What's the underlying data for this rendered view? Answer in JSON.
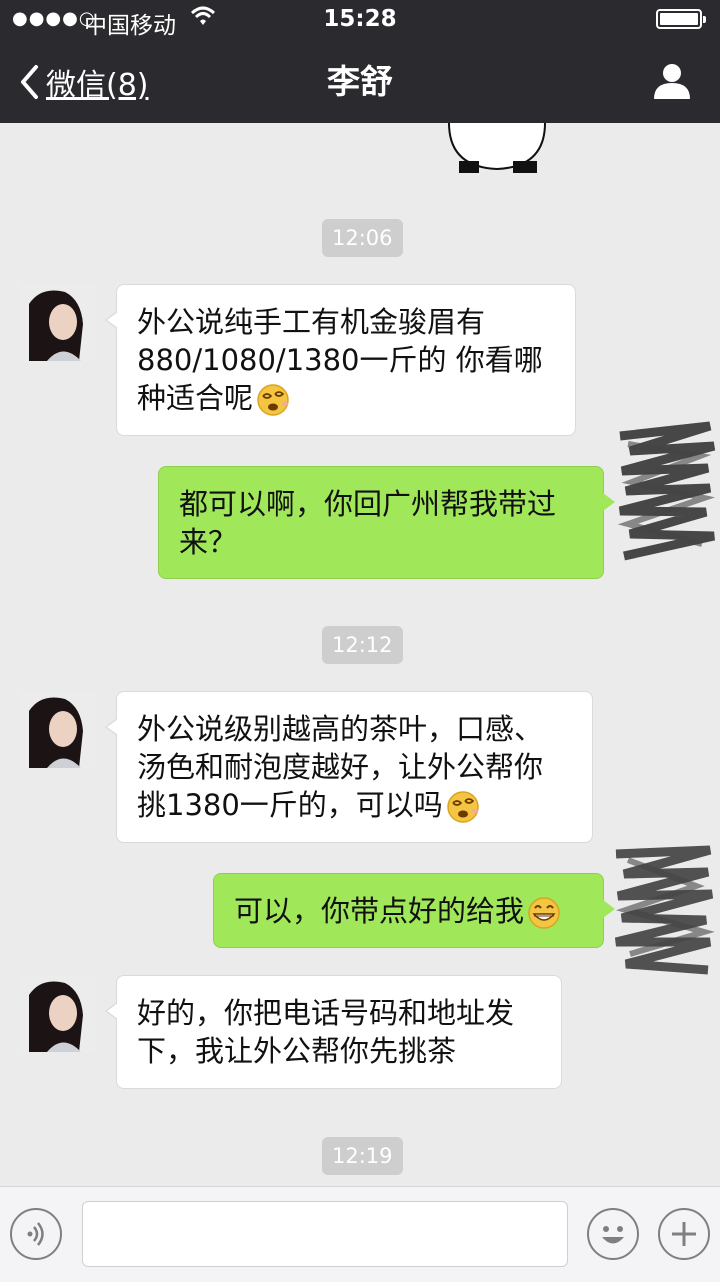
{
  "status_bar": {
    "signal": "●●●●○",
    "carrier": "中国移动",
    "time": "15:28"
  },
  "nav": {
    "back_label": "微信(8)",
    "title": "李舒"
  },
  "messages": [
    {
      "kind": "time",
      "text": "12:06"
    },
    {
      "kind": "left",
      "lines": [
        "外公说纯手工有机金骏眉有",
        "880/1080/1380一斤的  你看哪",
        "种适合呢"
      ],
      "emoji": "dizzy-face-emoji"
    },
    {
      "kind": "right",
      "lines": [
        "都可以啊，你回广州帮我带过",
        "来？"
      ]
    },
    {
      "kind": "time",
      "text": "12:12"
    },
    {
      "kind": "left",
      "lines": [
        "外公说级别越高的茶叶，口感、",
        "汤色和耐泡度越好，让外公帮你",
        "挑1380一斤的，可以吗"
      ],
      "emoji": "dizzy-face-emoji"
    },
    {
      "kind": "right",
      "lines": [
        "可以，你带点好的给我"
      ],
      "emoji": "grin-emoji"
    },
    {
      "kind": "left",
      "lines": [
        "好的，你把电话号码和地址发",
        "下，我让外公帮你先挑茶"
      ]
    },
    {
      "kind": "time",
      "text": "12:19"
    }
  ],
  "input": {
    "value": ""
  },
  "colors": {
    "nav_bg": "#2b2a2f",
    "chat_bg": "#ebebeb",
    "sent_bubble": "#a0e75a",
    "received_bubble": "#ffffff"
  }
}
